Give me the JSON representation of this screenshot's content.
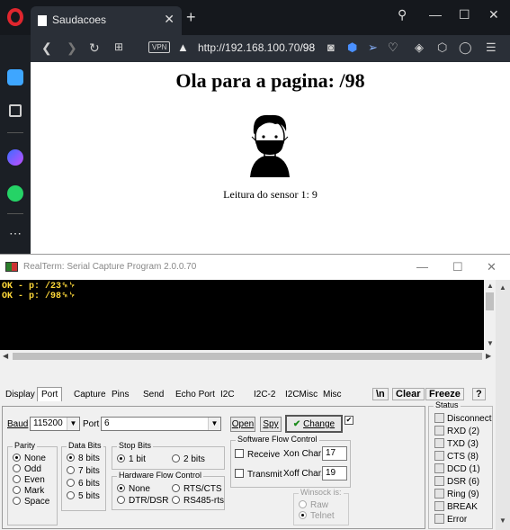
{
  "browser": {
    "tab_title": "Saudacoes",
    "vpn_label": "VPN",
    "url_host": "http://192.168.100.70",
    "url_path": "/98",
    "sidebar_icons": [
      "home-icon",
      "bookmark-icon",
      "messenger-icon",
      "whatsapp-icon",
      "more-icon"
    ],
    "accent_color": "#e0262e"
  },
  "page": {
    "heading": "Ola para a pagina: /98",
    "sensor_text": "Leitura do sensor 1: 9"
  },
  "realterm": {
    "title": "RealTerm: Serial Capture Program 2.0.0.70",
    "terminal_lines": [
      "OK - p: /23␍␊",
      "OK - p: /98␍␊"
    ],
    "tabs": [
      "Display",
      "Port",
      "Capture",
      "Pins",
      "Send",
      "Echo Port",
      "I2C",
      "I2C-2",
      "I2CMisc",
      "Misc"
    ],
    "active_tab": "Port",
    "toolbar": {
      "newline": "\\n",
      "clear": "Clear",
      "freeze": "Freeze",
      "help": "?"
    },
    "port": {
      "baud_label": "Baud",
      "baud_value": "115200",
      "port_label": "Port",
      "port_value": "6",
      "open_label": "Open",
      "spy_label": "Spy",
      "change_label": "Change"
    },
    "parity": {
      "title": "Parity",
      "options": [
        "None",
        "Odd",
        "Even",
        "Mark",
        "Space"
      ],
      "selected": "None"
    },
    "data_bits": {
      "title": "Data Bits",
      "options": [
        "8 bits",
        "7 bits",
        "6 bits",
        "5 bits"
      ],
      "selected": "8 bits"
    },
    "stop_bits": {
      "title": "Stop Bits",
      "options": [
        "1 bit",
        "2 bits"
      ],
      "selected": "1 bit"
    },
    "hw_flow": {
      "title": "Hardware Flow Control",
      "options": [
        "None",
        "RTS/CTS",
        "DTR/DSR",
        "RS485-rts"
      ],
      "selected": "None"
    },
    "sw_flow": {
      "title": "Software Flow Control",
      "receive_label": "Receive",
      "transmit_label": "Transmit",
      "xon_label": "Xon Char:",
      "xon_value": "17",
      "xoff_label": "Xoff Char:",
      "xoff_value": "19"
    },
    "winsock": {
      "title": "Winsock is:",
      "options": [
        "Raw",
        "Telnet"
      ],
      "selected": "Telnet"
    },
    "status": {
      "title": "Status",
      "items": [
        "Disconnect",
        "RXD (2)",
        "TXD (3)",
        "CTS (8)",
        "DCD (1)",
        "DSR (6)",
        "Ring (9)",
        "BREAK",
        "Error"
      ]
    }
  }
}
